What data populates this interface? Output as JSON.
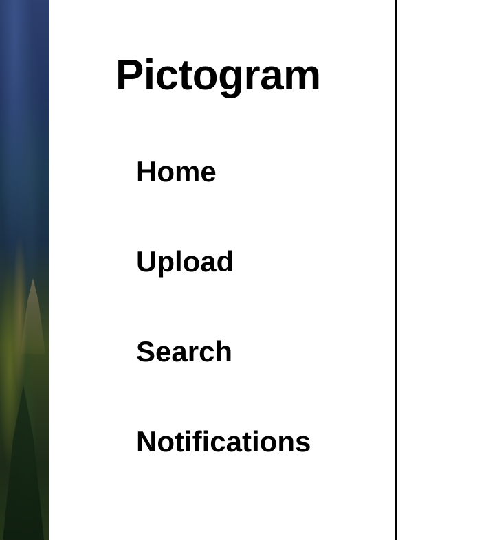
{
  "app": {
    "title": "Pictogram"
  },
  "sidebar": {
    "items": [
      {
        "label": "Home"
      },
      {
        "label": "Upload"
      },
      {
        "label": "Search"
      },
      {
        "label": "Notifications"
      }
    ]
  },
  "background": {
    "description_icon": "landscape-photo"
  }
}
